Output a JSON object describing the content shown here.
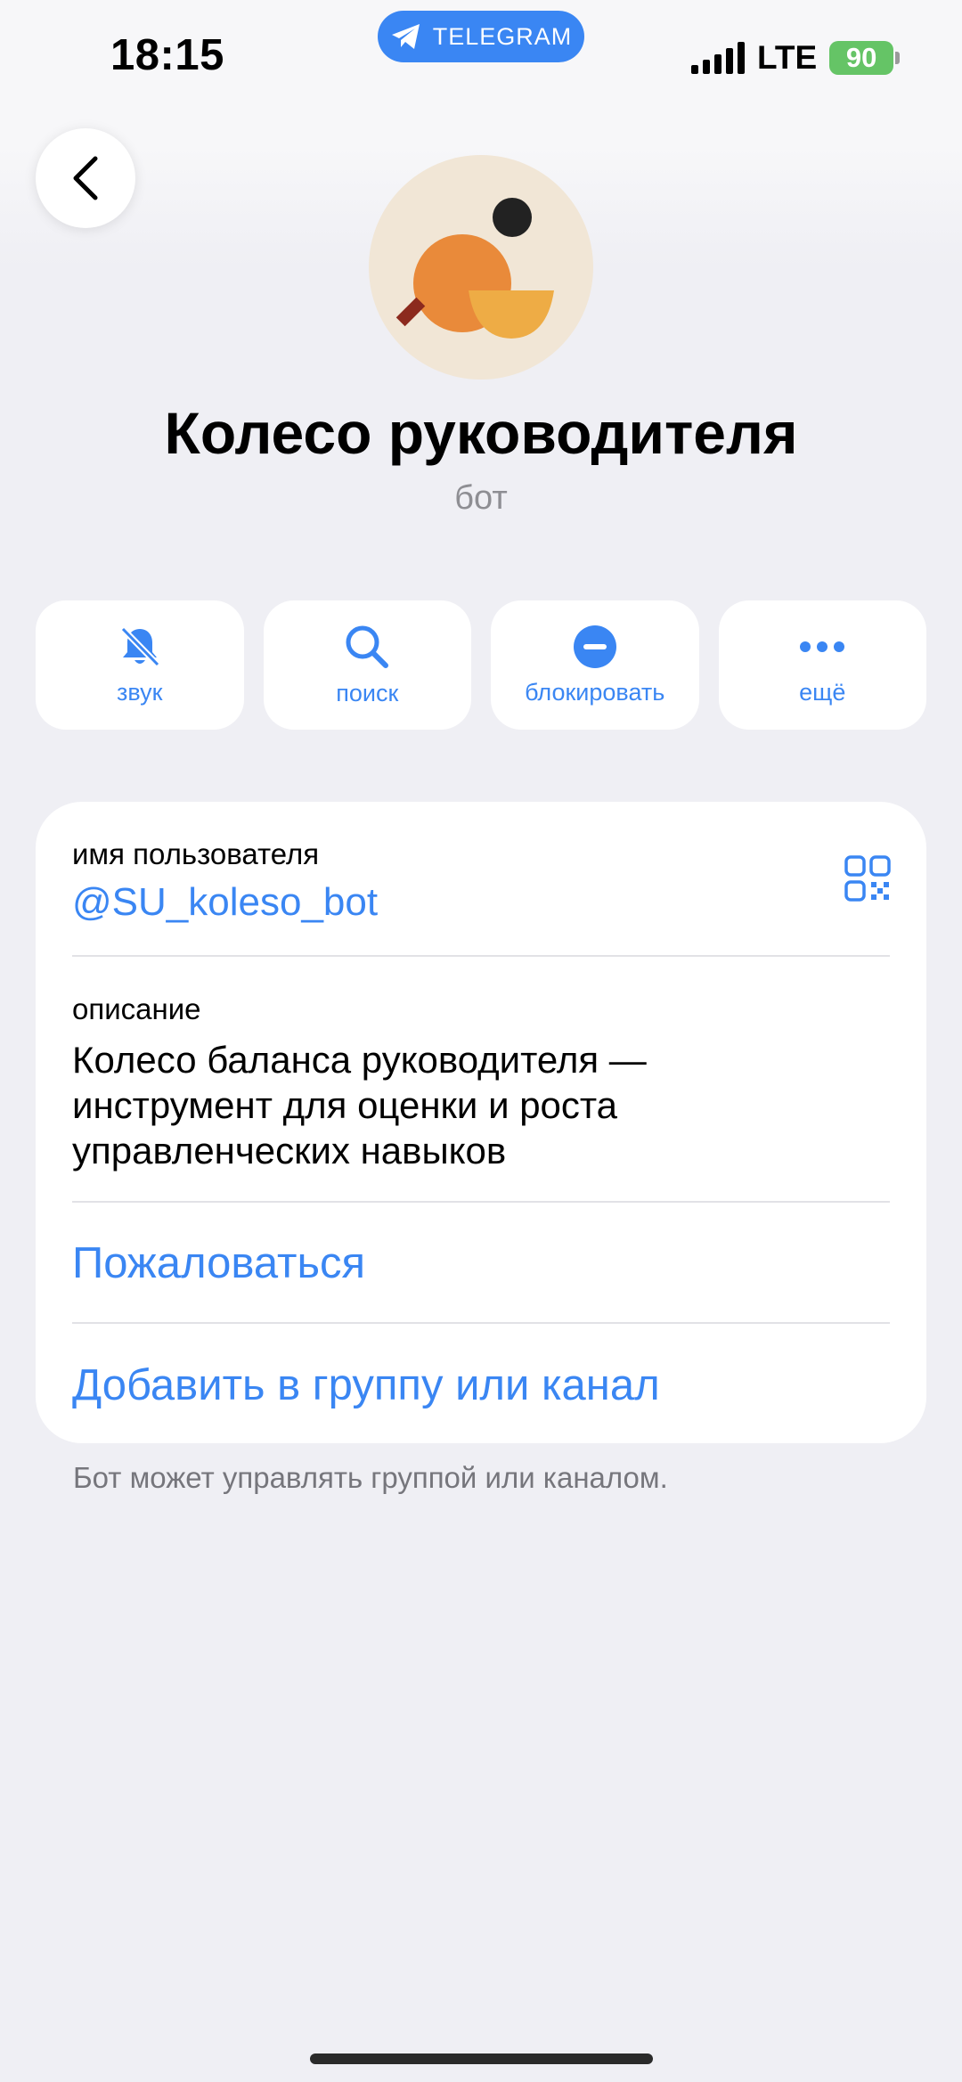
{
  "status_bar": {
    "time": "18:15",
    "app_pill": "TELEGRAM",
    "network": "LTE",
    "battery": "90"
  },
  "profile": {
    "name": "Колесо руководителя",
    "type": "бот"
  },
  "actions": [
    {
      "label": "звук",
      "icon": "bell-muted-icon"
    },
    {
      "label": "поиск",
      "icon": "search-icon"
    },
    {
      "label": "блокировать",
      "icon": "block-icon"
    },
    {
      "label": "ещё",
      "icon": "more-icon"
    }
  ],
  "info": {
    "username_label": "имя пользователя",
    "username": "@SU_koleso_bot",
    "description_label": "описание",
    "description_lines": [
      "Колесо баланса руководителя —",
      "инструмент для оценки и роста",
      "управленческих навыков"
    ],
    "report": "Пожаловаться",
    "add_to_group": "Добавить в группу или канал"
  },
  "footnote": "Бот может управлять группой или каналом.",
  "colors": {
    "accent": "#3a86f3",
    "background": "#efeff4",
    "battery": "#65c466"
  }
}
